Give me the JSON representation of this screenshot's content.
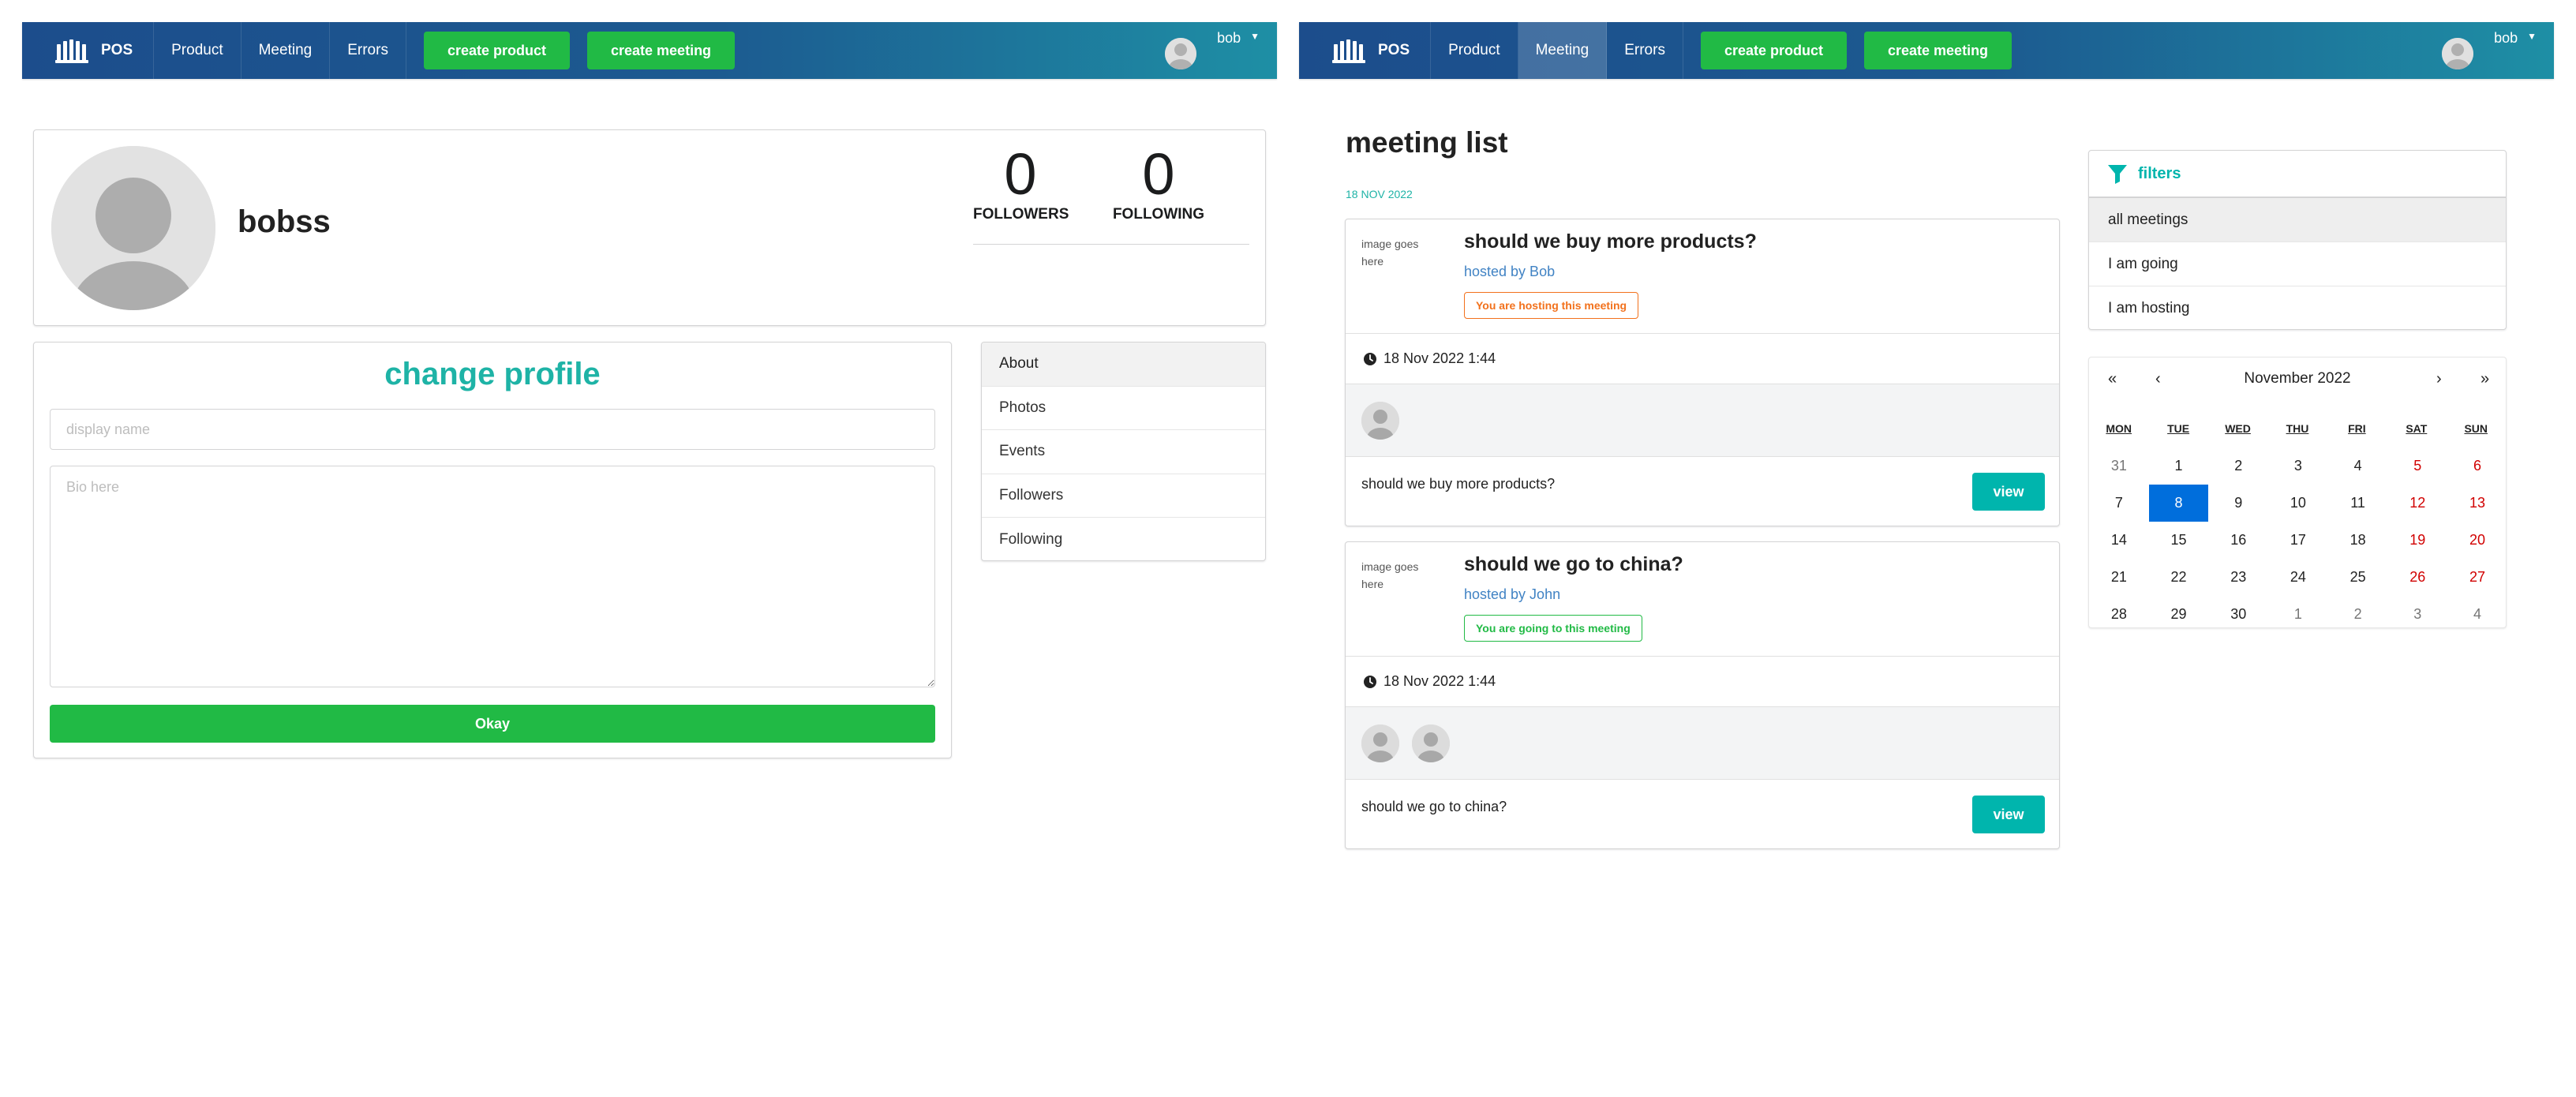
{
  "left": {
    "nav": {
      "brand": "POS",
      "items": [
        "Product",
        "Meeting",
        "Errors"
      ],
      "buttons": [
        "create product",
        "create meeting"
      ],
      "user": "bob"
    },
    "profile": {
      "name": "bobss",
      "followers_value": "0",
      "followers_label": "FOLLOWERS",
      "following_value": "0",
      "following_label": "FOLLOWING"
    },
    "change_profile": {
      "title": "change profile",
      "display_name_placeholder": "display name",
      "bio_placeholder": "Bio here",
      "okay_label": "Okay"
    },
    "menu": [
      "About",
      "Photos",
      "Events",
      "Followers",
      "Following"
    ]
  },
  "right": {
    "nav": {
      "brand": "POS",
      "items": [
        "Product",
        "Meeting",
        "Errors"
      ],
      "active_item": "Meeting",
      "buttons": [
        "create product",
        "create meeting"
      ],
      "user": "bob"
    },
    "page_title": "meeting list",
    "date_header": "18 NOV 2022",
    "meetings": [
      {
        "image_alt": "image goes here",
        "title": "should we buy more products?",
        "host": "hosted by Bob",
        "badge": "You are hosting this meeting",
        "badge_type": "hosting",
        "time": "18 Nov 2022 1:44",
        "attendees": 1,
        "description": "should we buy more products?",
        "view_label": "view"
      },
      {
        "image_alt": "image goes here",
        "title": "should we go to china?",
        "host": "hosted by John",
        "badge": "You are going to this meeting",
        "badge_type": "going",
        "time": "18 Nov 2022 1:44",
        "attendees": 2,
        "description": "should we go to china?",
        "view_label": "view"
      }
    ],
    "filters": {
      "title": "filters",
      "items": [
        "all meetings",
        "I am going",
        "I am hosting"
      ],
      "active": "all meetings"
    },
    "calendar": {
      "month": "November 2022",
      "nav": [
        "«",
        "‹",
        "›",
        "»"
      ],
      "weekdays": [
        "MON",
        "TUE",
        "WED",
        "THU",
        "FRI",
        "SAT",
        "SUN"
      ],
      "days": [
        "31",
        "1",
        "2",
        "3",
        "4",
        "5",
        "6",
        "7",
        "8",
        "9",
        "10",
        "11",
        "12",
        "13",
        "14",
        "15",
        "16",
        "17",
        "18",
        "19",
        "20",
        "21",
        "22",
        "23",
        "24",
        "25",
        "26",
        "27",
        "28",
        "29",
        "30",
        "1",
        "2",
        "3",
        "4"
      ],
      "selected_day": "8"
    }
  },
  "colors": {
    "nav_gradient_start": "#1c4d8c",
    "nav_gradient_end": "#1e8fa5",
    "green": "#21ba45",
    "teal": "#00b5ad",
    "orange": "#f2711c",
    "link": "#4183c4",
    "weekend_red": "#d10000",
    "selected_blue": "#006edc"
  },
  "icons": [
    "logo-icon",
    "avatar-icon",
    "caret-down-icon",
    "clock-icon",
    "filter-icon"
  ]
}
